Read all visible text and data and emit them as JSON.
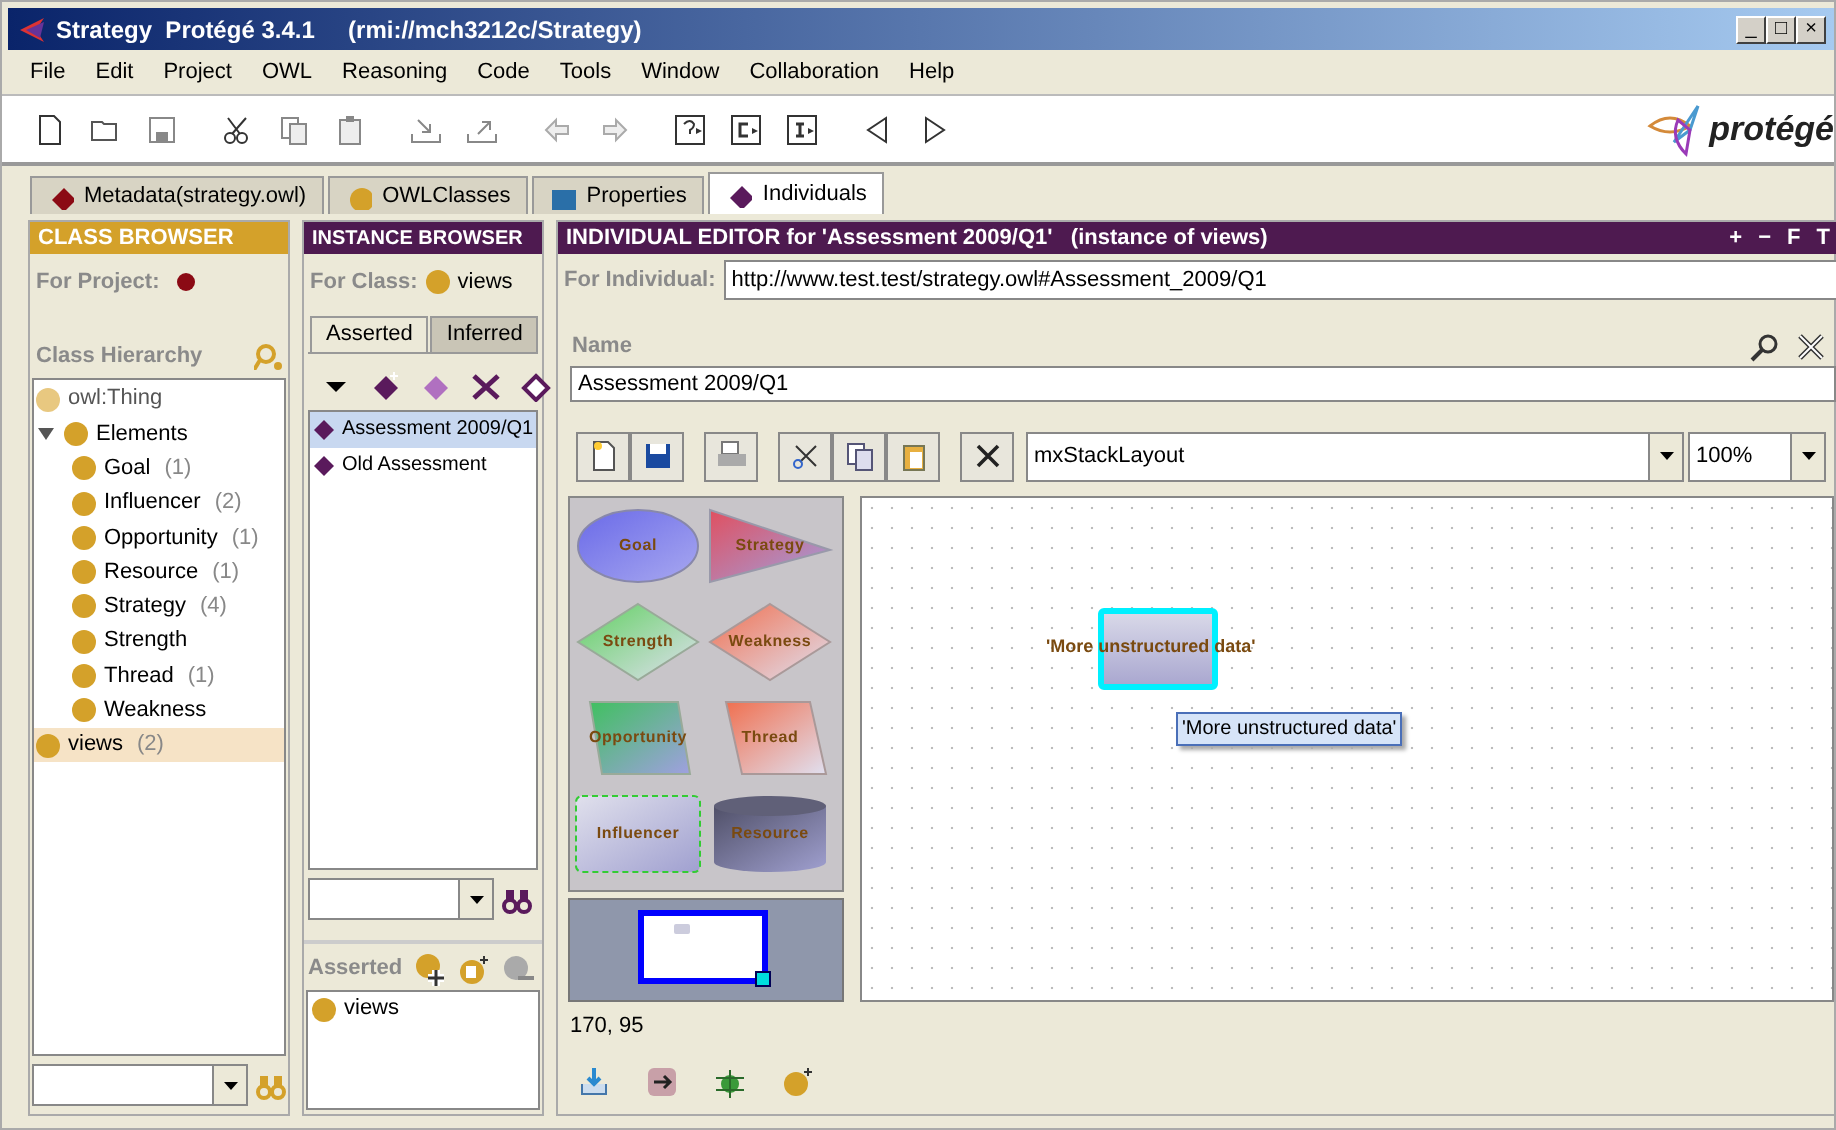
{
  "window": {
    "title": "Strategy  Protégé 3.4.1     (rmi://mch3212c/Strategy)",
    "controls": [
      "_",
      "□",
      "×"
    ]
  },
  "menu": [
    "File",
    "Edit",
    "Project",
    "OWL",
    "Reasoning",
    "Code",
    "Tools",
    "Window",
    "Collaboration",
    "Help"
  ],
  "logo": {
    "text": "protégé"
  },
  "tabs": [
    {
      "label": "Metadata(strategy.owl)",
      "selected": false,
      "kind": "diamond",
      "color": "#8b0a14"
    },
    {
      "label": "OWLClasses",
      "selected": false,
      "kind": "circle",
      "color": "#d4a12a"
    },
    {
      "label": "Properties",
      "selected": false,
      "kind": "square",
      "color": "#2a6fa8"
    },
    {
      "label": "Individuals",
      "selected": true,
      "kind": "diamond",
      "color": "#5a1a5c"
    }
  ],
  "class_browser": {
    "title": "CLASS BROWSER",
    "for_project_label": "For Project:",
    "hierarchy_label": "Class Hierarchy",
    "tree": [
      {
        "label": "owl:Thing",
        "selected": false,
        "system": true
      },
      {
        "label": "Elements",
        "selected": false,
        "expanded": true,
        "children": [
          {
            "label": "Goal",
            "count": "(1)",
            "selected": false
          },
          {
            "label": "Influencer",
            "count": "(2)",
            "selected": false
          },
          {
            "label": "Opportunity",
            "count": "(1)",
            "selected": false
          },
          {
            "label": "Resource",
            "count": "(1)",
            "selected": false
          },
          {
            "label": "Strategy",
            "count": "(4)",
            "selected": false
          },
          {
            "label": "Strength",
            "selected": false
          },
          {
            "label": "Thread",
            "count": "(1)",
            "selected": false
          },
          {
            "label": "Weakness",
            "selected": false
          }
        ]
      },
      {
        "label": "views",
        "count": "(2)",
        "selected": true
      }
    ]
  },
  "instance_browser": {
    "title": "INSTANCE BROWSER",
    "for_class_label": "For Class:",
    "for_class_value": "views",
    "tabs": [
      {
        "label": "Asserted",
        "selected": true
      },
      {
        "label": "Inferred",
        "selected": false
      }
    ],
    "instances": [
      {
        "label": "Assessment 2009/Q1",
        "selected": true
      },
      {
        "label": "Old Assessment",
        "selected": false
      }
    ],
    "asserted_label": "Asserted",
    "asserted_types": [
      "views"
    ]
  },
  "editor": {
    "title": "INDIVIDUAL EDITOR for 'Assessment 2009/Q1'   (instance of views)",
    "title_buttons": [
      "+",
      "−",
      "F",
      "T"
    ],
    "for_individual_label": "For Individual:",
    "for_individual_value": "http://www.test.test/strategy.owl#Assessment_2009/Q1",
    "name_label": "Name",
    "name_value": "Assessment 2009/Q1",
    "layout": "mxStackLayout",
    "zoom": "100%",
    "palette": [
      {
        "label": "Goal",
        "kind": "ellipse"
      },
      {
        "label": "Strategy",
        "kind": "triangle"
      },
      {
        "label": "Strength",
        "kind": "diamond-green"
      },
      {
        "label": "Weakness",
        "kind": "diamond-red"
      },
      {
        "label": "Opportunity",
        "kind": "para-green"
      },
      {
        "label": "Thread",
        "kind": "para-red"
      },
      {
        "label": "Influencer",
        "kind": "rect"
      },
      {
        "label": "Resource",
        "kind": "cylinder"
      }
    ],
    "node": {
      "label": "'More unstructured data'",
      "selected": true
    },
    "tooltip": "'More unstructured data'",
    "coordinates": "170, 95"
  }
}
